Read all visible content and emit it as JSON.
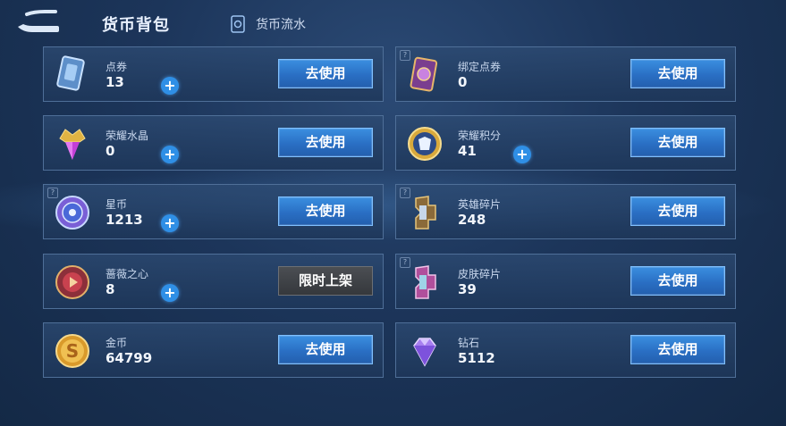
{
  "header": {
    "title": "货币背包",
    "flow_link": "货币流水"
  },
  "currencies": [
    {
      "id": "voucher",
      "name": "点券",
      "amount": "13",
      "has_plus": true,
      "has_help": false,
      "button": "去使用"
    },
    {
      "id": "bound-voucher",
      "name": "绑定点券",
      "amount": "0",
      "has_plus": false,
      "has_help": true,
      "button": "去使用"
    },
    {
      "id": "glory-crystal",
      "name": "荣耀水晶",
      "amount": "0",
      "has_plus": true,
      "has_help": false,
      "button": "去使用"
    },
    {
      "id": "glory-points",
      "name": "荣耀积分",
      "amount": "41",
      "has_plus": true,
      "has_help": false,
      "button": "去使用"
    },
    {
      "id": "star-coin",
      "name": "星币",
      "amount": "1213",
      "has_plus": true,
      "has_help": true,
      "button": "去使用"
    },
    {
      "id": "hero-shard",
      "name": "英雄碎片",
      "amount": "248",
      "has_plus": false,
      "has_help": true,
      "button": "去使用"
    },
    {
      "id": "rose-heart",
      "name": "蔷薇之心",
      "amount": "8",
      "has_plus": true,
      "has_help": false,
      "button": "限时上架"
    },
    {
      "id": "skin-shard",
      "name": "皮肤碎片",
      "amount": "39",
      "has_plus": false,
      "has_help": true,
      "button": "去使用"
    },
    {
      "id": "gold-coin",
      "name": "金币",
      "amount": "64799",
      "has_plus": false,
      "has_help": false,
      "button": "去使用"
    },
    {
      "id": "diamond",
      "name": "钻石",
      "amount": "5112",
      "has_plus": false,
      "has_help": false,
      "button": "去使用"
    }
  ],
  "colors": {
    "button_blue": "#2f7fd6",
    "plus_blue": "#2f8fe6",
    "limited_gray": "#3e4146"
  }
}
